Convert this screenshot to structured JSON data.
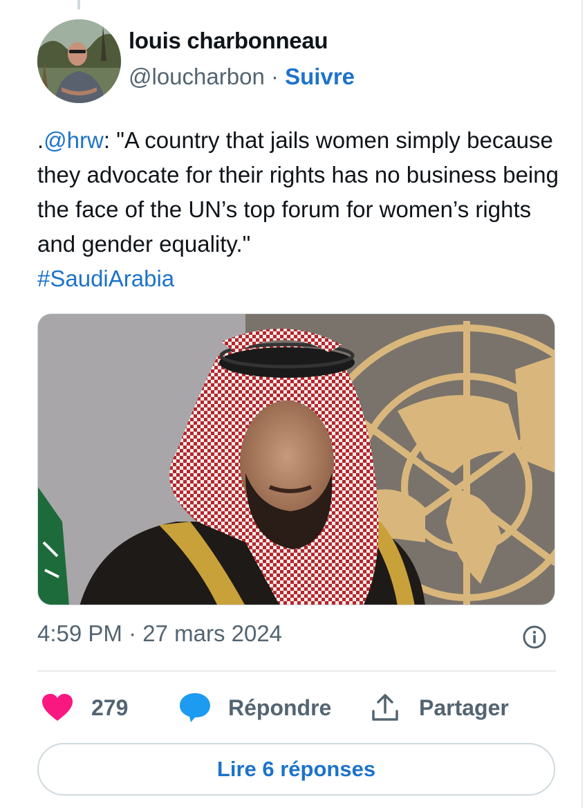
{
  "author": {
    "name": "louis charbonneau",
    "handle": "@loucharbon",
    "separator": "·",
    "follow_label": "Suivre"
  },
  "tweet": {
    "mention_prefix": ".",
    "mention": "@hrw",
    "text_line1": ": \"A country that jails women simply",
    "text_rest": "because they advocate for their rights has no business being the face of the UN’s top forum for women’s rights and gender equality.\"",
    "hashtag": "#SaudiArabia"
  },
  "meta": {
    "time": "4:59 PM",
    "separator": "·",
    "date": "27 mars 2024"
  },
  "actions": {
    "like_count": "279",
    "reply_label": "Répondre",
    "share_label": "Partager"
  },
  "read_replies_label": "Lire 6 réponses",
  "colors": {
    "link": "#1d73c9",
    "like": "#f91880",
    "reply": "#1d9bf0",
    "muted": "#536471"
  },
  "icons": [
    "info-icon",
    "heart-icon",
    "speech-bubble-icon",
    "share-upload-icon"
  ]
}
